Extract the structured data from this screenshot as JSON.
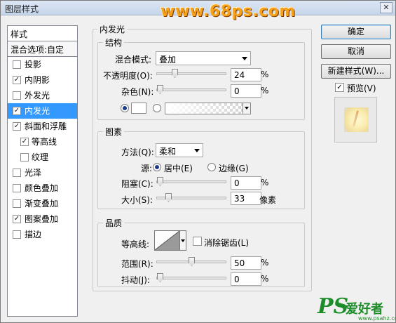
{
  "window": {
    "title": "图层样式",
    "close_label": "✕"
  },
  "watermark_url": "www.68ps.com",
  "sidebar": {
    "header": "样式",
    "blend_options": "混合选项:自定",
    "items": [
      {
        "label": "投影",
        "checked": false,
        "check": ""
      },
      {
        "label": "内阴影",
        "checked": true,
        "check": "✓"
      },
      {
        "label": "外发光",
        "checked": false,
        "check": ""
      },
      {
        "label": "内发光",
        "checked": true,
        "check": "✓",
        "selected": true
      },
      {
        "label": "斜面和浮雕",
        "checked": true,
        "check": "✓"
      },
      {
        "label": "等高线",
        "checked": true,
        "check": "✓",
        "indent": true
      },
      {
        "label": "纹理",
        "checked": false,
        "check": "",
        "indent": true
      },
      {
        "label": "光泽",
        "checked": false,
        "check": ""
      },
      {
        "label": "颜色叠加",
        "checked": false,
        "check": ""
      },
      {
        "label": "渐变叠加",
        "checked": false,
        "check": ""
      },
      {
        "label": "图案叠加",
        "checked": true,
        "check": "✓"
      },
      {
        "label": "描边",
        "checked": false,
        "check": ""
      }
    ]
  },
  "panel": {
    "title": "内发光",
    "structure": {
      "title": "结构",
      "blend_mode_label": "混合模式:",
      "blend_mode_value": "叠加",
      "opacity_label": "不透明度(O):",
      "opacity_value": "24",
      "opacity_fraction": 0.24,
      "noise_label": "杂色(N):",
      "noise_value": "0",
      "noise_fraction": 0,
      "unit_percent": "%",
      "color_swatch": "#ffffff"
    },
    "elements": {
      "title": "图素",
      "method_label": "方法(Q):",
      "method_value": "柔和",
      "source_label": "源:",
      "source_center": "居中(E)",
      "source_edge": "边缘(G)",
      "choke_label": "阻塞(C):",
      "choke_value": "0",
      "choke_fraction": 0,
      "size_label": "大小(S):",
      "size_value": "33",
      "size_fraction": 0.133,
      "unit_px": "像素"
    },
    "quality": {
      "title": "品质",
      "contour_label": "等高线:",
      "antialias_label": "消除锯齿(L)",
      "range_label": "范围(R):",
      "range_value": "50",
      "range_fraction": 0.5,
      "jitter_label": "抖动(J):",
      "jitter_value": "0",
      "jitter_fraction": 0
    }
  },
  "buttons": {
    "ok": "确定",
    "cancel": "取消",
    "new_style": "新建样式(W)...",
    "preview_label": "预览(V)",
    "preview_check": "✓"
  },
  "logo": {
    "ps": "PS",
    "name": "爱好者",
    "url": "www.psahz.com"
  },
  "colors": {
    "selection": "#3399ff",
    "logo_green": "#1d8d2a",
    "watermark_orange": "#f7a11b"
  }
}
